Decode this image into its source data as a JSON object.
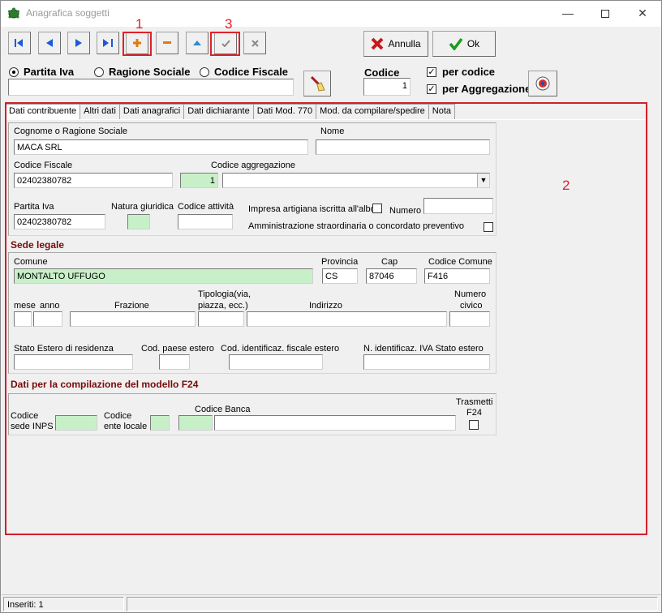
{
  "window": {
    "title": "Anagrafica soggetti",
    "minimize": "—",
    "close": "✕"
  },
  "toolbar": {
    "first_icon": "first-record-icon",
    "prev_icon": "prev-record-icon",
    "next_icon": "next-record-icon",
    "last_icon": "last-record-icon",
    "add_icon": "add-icon",
    "delete_icon": "delete-icon",
    "edit_icon": "edit-icon",
    "confirm_icon": "confirm-icon",
    "cancel_icon": "cancel-icon",
    "annotation_1": "1",
    "annotation_3": "3",
    "annulla_label": "Annulla",
    "ok_label": "Ok"
  },
  "search": {
    "options": [
      "Partita Iva",
      "Ragione Sociale",
      "Codice Fiscale"
    ],
    "selected": "Partita Iva",
    "value": "",
    "codice_label": "Codice",
    "codice_value": "1",
    "per_codice_label": "per codice",
    "per_codice_checked": "✓",
    "per_aggregazione_label": "per Aggregazione",
    "per_aggregazione_checked": "✓"
  },
  "tabs": [
    "Dati contribuente",
    "Altri dati",
    "Dati anagrafici",
    "Dati dichiarante",
    "Dati Mod. 770",
    "Mod. da compilare/spedire",
    "Nota"
  ],
  "annotation_2": "2",
  "contribuente": {
    "cognome_label": "Cognome o Ragione Sociale",
    "cognome_value": "MACA SRL",
    "nome_label": "Nome",
    "nome_value": "",
    "cf_label": "Codice Fiscale",
    "cf_value": "02402380782",
    "aggr_num": "1",
    "aggr_label": "Codice aggregazione",
    "aggr_value": "",
    "piva_label": "Partita Iva",
    "piva_value": "02402380782",
    "natura_label": "Natura giuridica",
    "natura_value": "",
    "attivita_label": "Codice attività",
    "attivita_value": "",
    "impresa_label": "Impresa artigiana iscritta all'albo",
    "numero_label": "Numero",
    "numero_value": "",
    "amministrazione_label": "Amministrazione straordinaria o concordato preventivo"
  },
  "sede": {
    "title": "Sede legale",
    "comune_label": "Comune",
    "comune_value": "MONTALTO UFFUGO",
    "provincia_label": "Provincia",
    "provincia_value": "CS",
    "cap_label": "Cap",
    "cap_value": "87046",
    "codcomune_label": "Codice Comune",
    "codcomune_value": "F416",
    "mese_label": "mese",
    "anno_label": "anno",
    "frazione_label": "Frazione",
    "tipologia_label_1": "Tipologia(via,",
    "tipologia_label_2": "piazza, ecc.)",
    "indirizzo_label": "Indirizzo",
    "civico_label_1": "Numero",
    "civico_label_2": "civico",
    "estero_label": "Stato Estero di residenza",
    "paese_label": "Cod. paese estero",
    "identificaz_label": "Cod. identificaz. fiscale estero",
    "iva_estero_label": "N. identificaz. IVA Stato estero"
  },
  "f24": {
    "title": "Dati per la compilazione del modello F24",
    "inps_label_1": "Codice",
    "inps_label_2": "sede INPS",
    "ente_label_1": "Codice",
    "ente_label_2": "ente locale",
    "banca_label": "Codice Banca",
    "trasmetti_label_1": "Trasmetti",
    "trasmetti_label_2": "F24"
  },
  "status": {
    "inseriti": "Inseriti: 1"
  }
}
